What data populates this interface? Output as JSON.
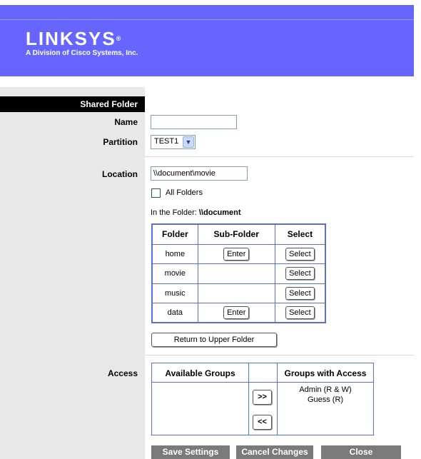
{
  "brand": {
    "logo_text": "LINKSYS",
    "logo_mark": "®",
    "subtitle": "A Division of Cisco Systems, Inc."
  },
  "section": {
    "title": "Shared Folder"
  },
  "form": {
    "name_label": "Name",
    "name_value": "",
    "partition_label": "Partition",
    "partition_value": "TEST1",
    "location_label": "Location",
    "location_value": "\\\\document\\movie",
    "all_folders_label": "All Folders",
    "all_folders_checked": false,
    "in_folder_prefix": "In the Folder: ",
    "in_folder_value": "\\\\document"
  },
  "folder_table": {
    "headers": [
      "Folder",
      "Sub-Folder",
      "Select"
    ],
    "rows": [
      {
        "folder": "home",
        "enter": "Enter",
        "select": "Select"
      },
      {
        "folder": "movie",
        "enter": "",
        "select": "Select"
      },
      {
        "folder": "music",
        "enter": "",
        "select": "Select"
      },
      {
        "folder": "data",
        "enter": "Enter",
        "select": "Select"
      }
    ],
    "return_label": "Return to Upper Folder"
  },
  "access": {
    "label": "Access",
    "available_header": "Available Groups",
    "with_access_header": "Groups with Access",
    "add_button": ">>",
    "remove_button": "<<",
    "groups_with_access": [
      "Admin (R & W)",
      "Guess (R)"
    ]
  },
  "footer": {
    "save_label": "Save Settings",
    "cancel_label": "Cancel Changes",
    "close_label": "Close"
  },
  "colors": {
    "header_blue": "#6666ff",
    "section_bar": "#000000",
    "table_border": "#5a6fd0",
    "footer_button": "#7a7a7a"
  }
}
